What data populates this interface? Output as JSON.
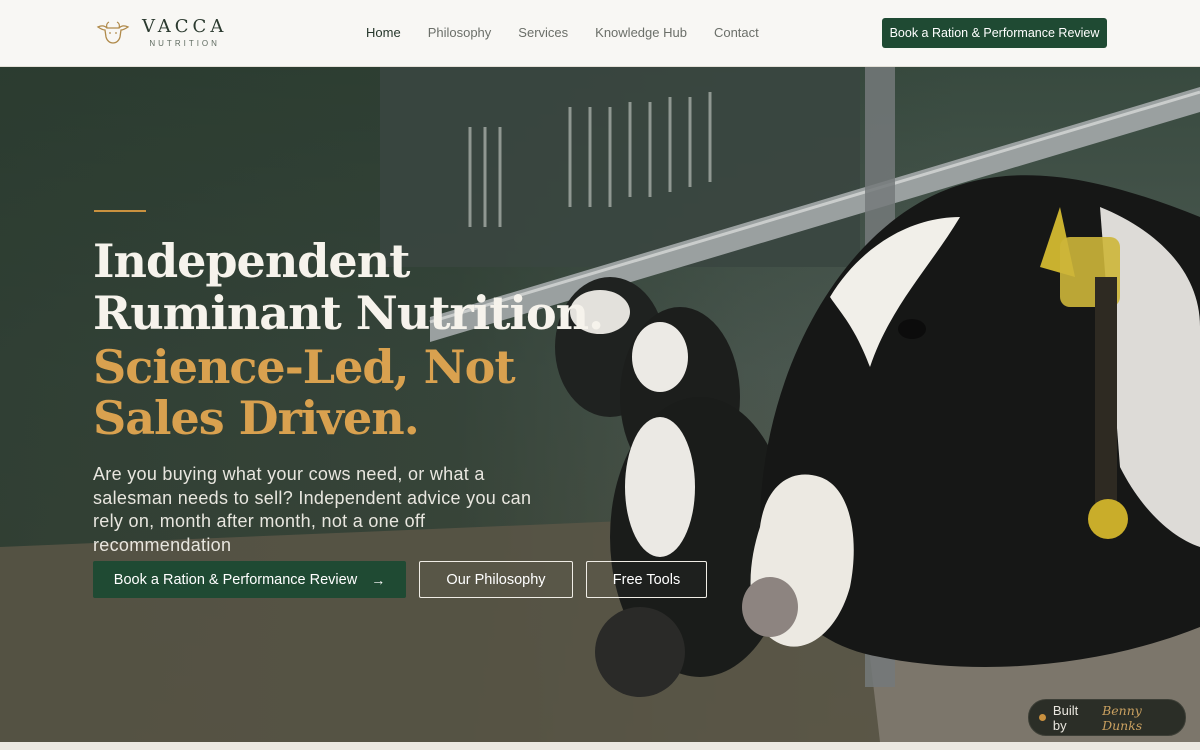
{
  "brand": {
    "name": "VACCA",
    "subtitle": "NUTRITION",
    "logo_icon": "cow-head-icon"
  },
  "nav": {
    "items": [
      {
        "label": "Home",
        "active": true
      },
      {
        "label": "Philosophy",
        "active": false
      },
      {
        "label": "Services",
        "active": false
      },
      {
        "label": "Knowledge Hub",
        "active": false
      },
      {
        "label": "Contact",
        "active": false
      }
    ],
    "cta_label": "Book a Ration & Performance Review"
  },
  "hero": {
    "headline": "Independent Ruminant Nutrition.",
    "subheadline": "Science-Led, Not Sales Driven.",
    "body": "Are you buying what your cows need, or what a salesman needs to sell? Independent advice you can rely on, month after month, not a one off recommendation",
    "buttons": {
      "primary": "Book a Ration & Performance Review",
      "primary_icon": "arrow-right-icon",
      "philosophy": "Our Philosophy",
      "tools": "Free Tools"
    },
    "background_image": "dairy cows feeding at barn feed barrier"
  },
  "badge": {
    "prefix": "Built by",
    "name": "Benny Dunks"
  },
  "colors": {
    "brand_green": "#1f4a33",
    "accent_gold": "#d9a14f",
    "header_bg": "#f8f7f4",
    "badge_bg": "#2b2e27"
  }
}
